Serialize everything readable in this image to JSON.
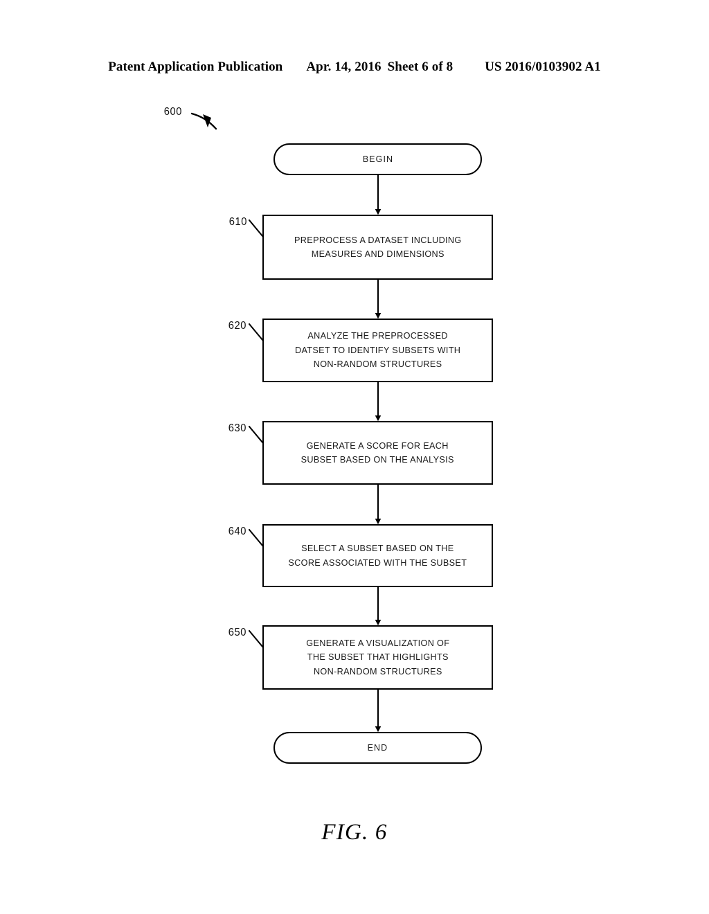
{
  "header": {
    "publication": "Patent Application Publication",
    "date": "Apr. 14, 2016",
    "sheet": "Sheet 6 of 8",
    "patent_number": "US 2016/0103902 A1"
  },
  "figure": {
    "caption": "FIG. 6",
    "diagram_number": "600",
    "nodes": [
      {
        "id": "begin",
        "ref": "",
        "shape": "terminator",
        "label": "BEGIN"
      },
      {
        "id": "610",
        "ref": "610",
        "shape": "process",
        "label": "PREPROCESS A DATASET INCLUDING\nMEASURES AND DIMENSIONS"
      },
      {
        "id": "620",
        "ref": "620",
        "shape": "process",
        "label": "ANALYZE THE PREPROCESSED\nDATSET TO IDENTIFY SUBSETS WITH\nNON-RANDOM STRUCTURES"
      },
      {
        "id": "630",
        "ref": "630",
        "shape": "process",
        "label": "GENERATE A SCORE FOR EACH\nSUBSET BASED ON THE ANALYSIS"
      },
      {
        "id": "640",
        "ref": "640",
        "shape": "process",
        "label": "SELECT A SUBSET BASED ON THE\nSCORE ASSOCIATED WITH THE SUBSET"
      },
      {
        "id": "650",
        "ref": "650",
        "shape": "process",
        "label": "GENERATE A VISUALIZATION OF\nTHE SUBSET THAT HIGHLIGHTS\nNON-RANDOM STRUCTURES"
      },
      {
        "id": "end",
        "ref": "",
        "shape": "terminator",
        "label": "END"
      }
    ],
    "connectors": [
      {
        "from": "begin",
        "to": "610"
      },
      {
        "from": "610",
        "to": "620"
      },
      {
        "from": "620",
        "to": "630"
      },
      {
        "from": "630",
        "to": "640"
      },
      {
        "from": "640",
        "to": "650"
      },
      {
        "from": "650",
        "to": "end"
      }
    ],
    "colors": {
      "stroke": "#000000",
      "fill": "#ffffff"
    }
  }
}
